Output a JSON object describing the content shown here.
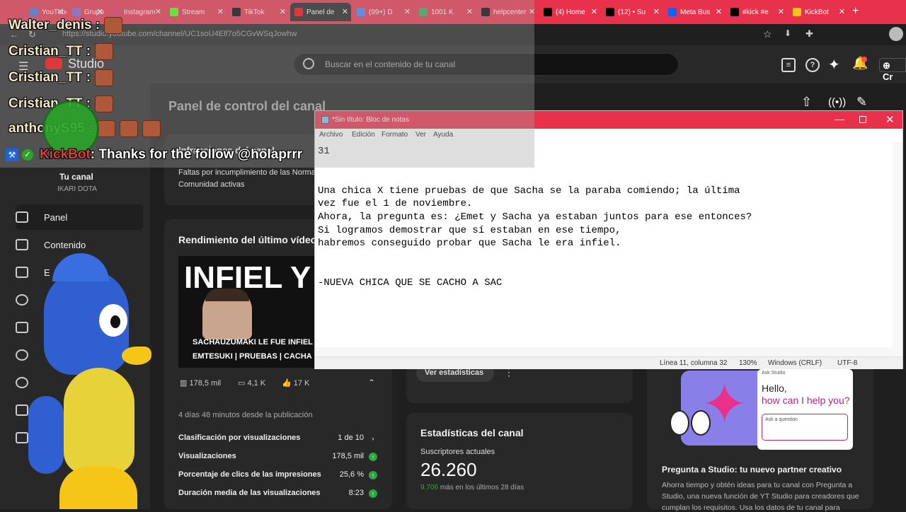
{
  "browser": {
    "tabs": [
      {
        "label": "YouTube",
        "color": "#4a6ee0"
      },
      {
        "label": "Grupo 2",
        "color": "#8a5cd6"
      },
      {
        "label": "Instagram",
        "color": "#e1306c"
      },
      {
        "label": "Stream",
        "color": "#53fc18"
      },
      {
        "label": "TikTok",
        "color": "#000000"
      },
      {
        "label": "Panel de",
        "color": "#ff0000"
      },
      {
        "label": "(99+) D",
        "color": "#4285f4"
      },
      {
        "label": "1001 K",
        "color": "#34a853"
      },
      {
        "label": "helpcenter",
        "color": "#000000"
      },
      {
        "label": "(4) Home",
        "color": "#000000"
      },
      {
        "label": "(12) • Su",
        "color": "#000000"
      },
      {
        "label": "Meta Bus",
        "color": "#0866ff"
      },
      {
        "label": "#kick #e",
        "color": "#000000"
      },
      {
        "label": "KickBot",
        "color": "#f7c41d"
      }
    ],
    "new_tab": "+",
    "url": "https://studio.youtube.com/channel/UC1soU4Elf7o5CGvWSqJowhw"
  },
  "studio": {
    "logo_text": "Studio",
    "search_placeholder": "Buscar en el contenido de tu canal",
    "create_label": "Cr",
    "page_title": "Panel de control del canal"
  },
  "sidebar": {
    "channel_label": "Tu canal",
    "channel_name": "IKARI DOTA",
    "items": [
      {
        "label": "Panel"
      },
      {
        "label": "Contenido"
      },
      {
        "label": "E"
      }
    ]
  },
  "infractions": {
    "title": "Infracciones del canal",
    "text1": "Faltas por incumplimiento de las Normas",
    "text2": "Comunidad activas"
  },
  "last_video": {
    "title": "Rendimiento del último vídeo",
    "thumb_big": "INFIEL Y",
    "thumb_line1": "SACHAUZUMAKI LE FUE INFIEL",
    "thumb_line2": "EMTESUKI | PRUEBAS | CACHA",
    "views": "178,5 mil",
    "comments": "4,1 K",
    "likes": "17 K",
    "published": "4 días 48 minutos desde la publicación",
    "stats": [
      {
        "label": "Clasificación por visualizaciones",
        "value": "1 de 10"
      },
      {
        "label": "Visualizaciones",
        "value": "178,5 mil"
      },
      {
        "label": "Porcentaje de clics de las impresiones",
        "value": "25,6 %"
      },
      {
        "label": "Duración media de las visualizaciones",
        "value": "8:23"
      }
    ]
  },
  "middle": {
    "view_stats_button": "Ver estadísticas",
    "channel_stats_title": "Estadísticas del canal",
    "subs_label": "Suscriptores actuales",
    "subs_value": "26.260",
    "subs_delta_num": "9.706",
    "subs_delta_text": "más en los últimos 28 días"
  },
  "ask_studio": {
    "badge": "Ask Studio",
    "hello": "Hello,",
    "help": "how can I help you?",
    "ask_placeholder": "Ask a question",
    "title": "Pregunta a Studio: tu nuevo partner creativo",
    "body1": "Ahorra tiempo y obtén ideas para tu canal con Pregunta a",
    "body2": "Studio, una nueva función de YT Studio para creadores que",
    "body3": "cumplan los requisitos. Usa los datos de tu canal para"
  },
  "notepad": {
    "title": "*Sin título: Bloc de notas",
    "menu": [
      "Archivo",
      "Edición",
      "Formato",
      "Ver",
      "Ayuda"
    ],
    "content": "31\n\n\nUna chica X tiene pruebas de que Sacha se la paraba comiendo; la última\nvez fue el 1 de noviembre.\nAhora, la pregunta es: ¿Emet y Sacha ya estaban juntos para ese entonces?\nSi logramos demostrar que sí estaban en ese tiempo,\nhabremos conseguido probar que Sacha le era infiel.\n\n\n-NUEVA CHICA QUE SE CACHO A SAC",
    "status_pos": "Línea 11, columna 32",
    "status_zoom": "130%",
    "status_eol": "Windows (CRLF)",
    "status_enc": "UTF-8"
  },
  "chat": [
    {
      "user": "Walter_denis :"
    },
    {
      "user": "Cristian_TT :"
    },
    {
      "user": "Cristian_TT :"
    },
    {
      "user": "Cristian_TT :"
    },
    {
      "user": "anthonyS95 :"
    }
  ],
  "kickbot": {
    "name": "KickBot",
    "message": ": Thanks for the follow @holaprrr"
  }
}
